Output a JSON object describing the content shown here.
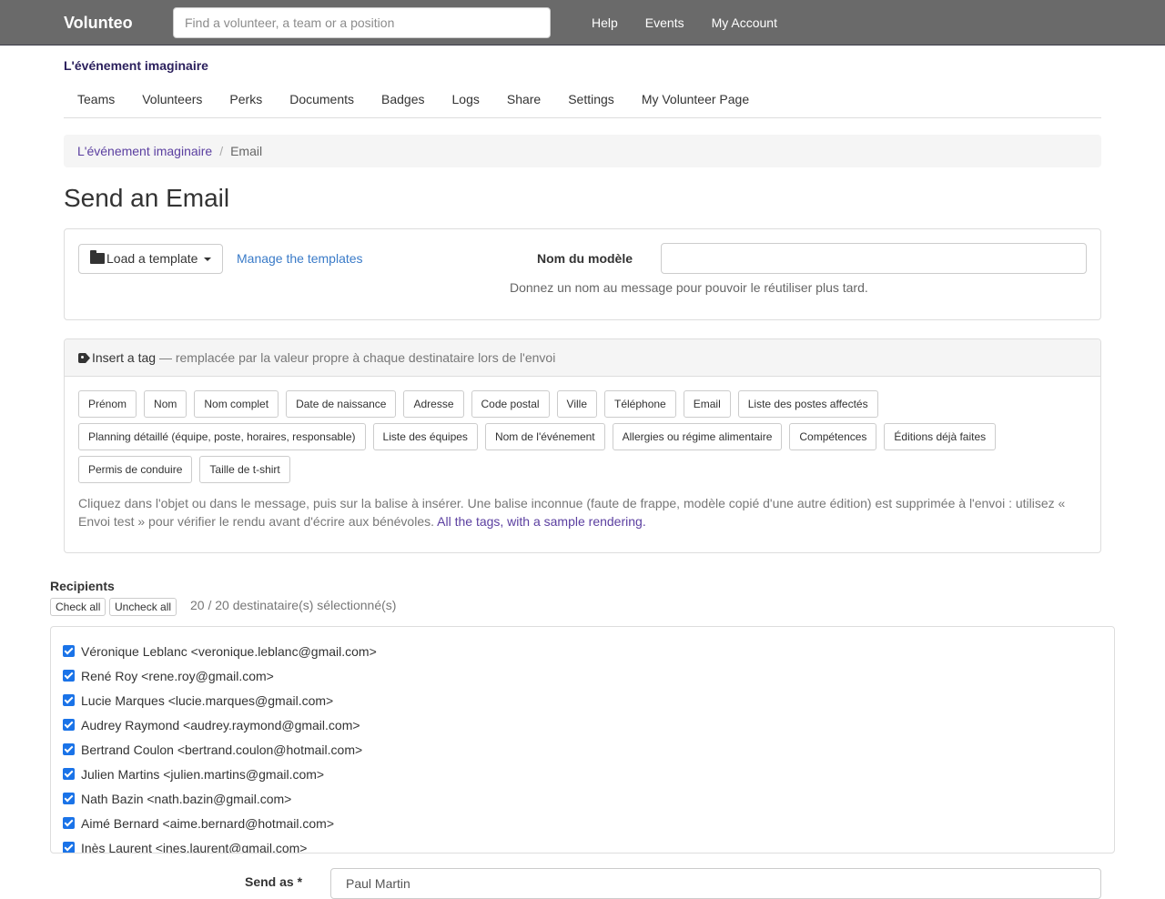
{
  "header": {
    "brand": "Volunteo",
    "search_placeholder": "Find a volunteer, a team or a position",
    "nav": [
      "Help",
      "Events",
      "My Account"
    ]
  },
  "event": {
    "title": "L'événement imaginaire",
    "tabs": [
      "Teams",
      "Volunteers",
      "Perks",
      "Documents",
      "Badges",
      "Logs",
      "Share",
      "Settings",
      "My Volunteer Page"
    ]
  },
  "breadcrumb": {
    "event": "L'événement imaginaire",
    "separator": "/",
    "current": "Email"
  },
  "page_title": "Send an Email",
  "template": {
    "load_label": "Load a template",
    "manage_label": "Manage the templates",
    "name_label": "Nom du modèle",
    "name_value": "",
    "help": "Donnez un nom au message pour pouvoir le réutiliser plus tard."
  },
  "tags": {
    "heading": "Insert a tag",
    "heading_desc": "— remplacée par la valeur propre à chaque destinataire lors de l'envoi",
    "buttons": [
      "Prénom",
      "Nom",
      "Nom complet",
      "Date de naissance",
      "Adresse",
      "Code postal",
      "Ville",
      "Téléphone",
      "Email",
      "Liste des postes affectés",
      "Planning détaillé (équipe, poste, horaires, responsable)",
      "Liste des équipes",
      "Nom de l'événement",
      "Allergies ou régime alimentaire",
      "Compétences",
      "Éditions déjà faites",
      "Permis de conduire",
      "Taille de t-shirt"
    ],
    "help": "Cliquez dans l'objet ou dans le message, puis sur la balise à insérer. Une balise inconnue (faute de frappe, modèle copié d'une autre édition) est supprimée à l'envoi : utilisez « Envoi test » pour vérifier le rendu avant d'écrire aux bénévoles.",
    "help_link": "All the tags, with a sample rendering."
  },
  "recipients": {
    "label": "Recipients",
    "check_all": "Check all",
    "uncheck_all": "Uncheck all",
    "count": "20 / 20 destinataire(s) sélectionné(s)",
    "list": [
      "Véronique Leblanc <veronique.leblanc@gmail.com>",
      "René Roy <rene.roy@gmail.com>",
      "Lucie Marques <lucie.marques@gmail.com>",
      "Audrey Raymond <audrey.raymond@gmail.com>",
      "Bertrand Coulon <bertrand.coulon@hotmail.com>",
      "Julien Martins <julien.martins@gmail.com>",
      "Nath Bazin <nath.bazin@gmail.com>",
      "Aimé Bernard <aime.bernard@hotmail.com>",
      "Inès Laurent <ines.laurent@gmail.com>"
    ]
  },
  "send_as": {
    "label": "Send as *",
    "value": "Paul Martin"
  }
}
